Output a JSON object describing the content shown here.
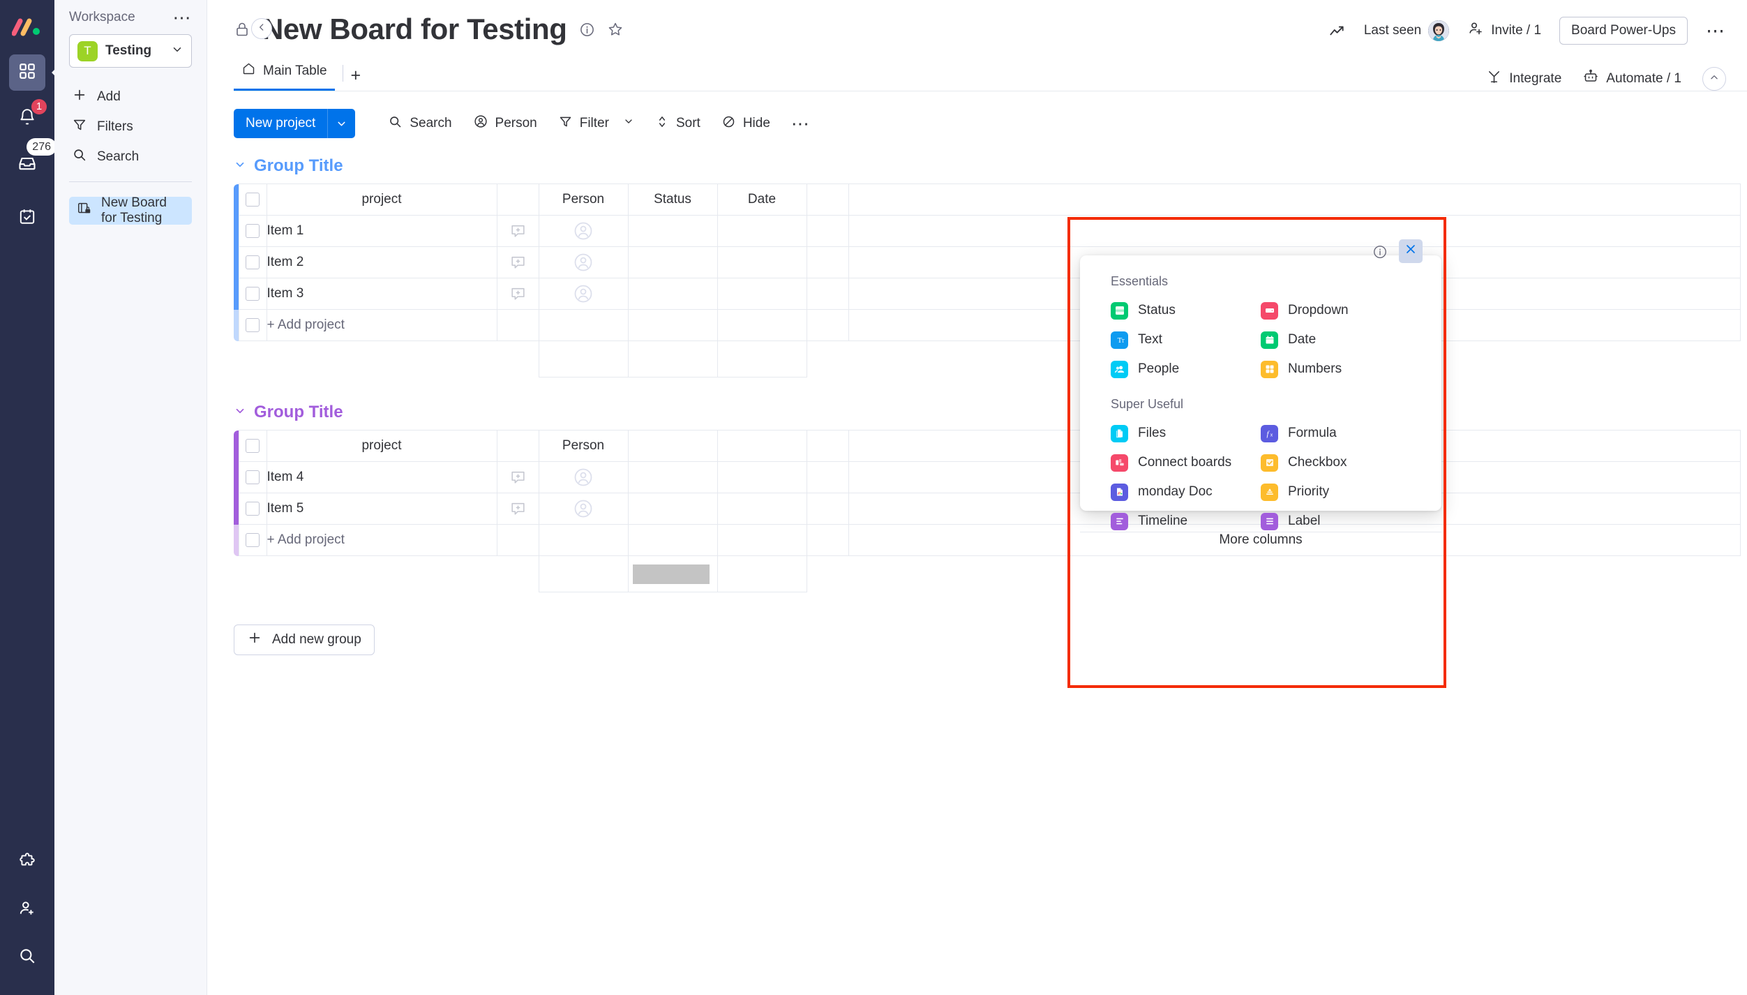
{
  "rail": {
    "logo_name": "monday-logo",
    "items": [
      {
        "name": "apps-grid-icon",
        "badge": ""
      },
      {
        "name": "bell-icon",
        "badge": "1"
      },
      {
        "name": "inbox-icon",
        "badge": "276"
      },
      {
        "name": "my-work-calendar-icon",
        "badge": ""
      }
    ],
    "bottom_items": [
      {
        "name": "puzzle-icon"
      },
      {
        "name": "invite-member-icon"
      },
      {
        "name": "search-icon"
      }
    ]
  },
  "sidebar": {
    "workspace_label": "Workspace",
    "more_icon": "more-dots-icon",
    "workspace_avatar_letter": "T",
    "workspace_name": "Testing",
    "nav": [
      {
        "label": "Add",
        "icon": "plus-icon"
      },
      {
        "label": "Filters",
        "icon": "funnel-icon"
      },
      {
        "label": "Search",
        "icon": "search-icon"
      }
    ],
    "board": {
      "label": "New Board for Testing",
      "icon": "private-board-icon"
    },
    "collapse_icon": "chevron-left-icon"
  },
  "header": {
    "lock_icon": "lock-icon",
    "title": "New Board for Testing",
    "info_icon": "info-circle-icon",
    "star_icon": "star-icon",
    "activity_icon": "activity-trend-icon",
    "last_seen_label": "Last seen",
    "avatar_name": "user-avatar",
    "invite_label": "Invite / 1",
    "invite_icon": "add-person-icon",
    "power_ups_label": "Board Power-Ups",
    "more_icon": "more-dots-icon",
    "integrate_label": "Integrate",
    "integrate_icon": "integrate-icon",
    "automate_label": "Automate / 1",
    "automate_icon": "robot-icon",
    "collapse_header_icon": "chevron-up-icon",
    "tabs": [
      {
        "label": "Main Table",
        "icon": "home-icon",
        "active": true
      }
    ],
    "add_tab_label": "+"
  },
  "toolbar": {
    "new_project_label": "New project",
    "new_project_caret": "chevron-down-icon",
    "items": [
      {
        "label": "Search",
        "icon": "search-icon",
        "caret": false
      },
      {
        "label": "Person",
        "icon": "person-circle-icon",
        "caret": false
      },
      {
        "label": "Filter",
        "icon": "funnel-icon",
        "caret": true
      },
      {
        "label": "Sort",
        "icon": "sort-arrows-icon",
        "caret": false
      },
      {
        "label": "Hide",
        "icon": "hide-eye-icon",
        "caret": false
      }
    ],
    "more_icon": "more-dots-icon"
  },
  "table": {
    "columns": [
      "project",
      "Person",
      "Status",
      "Date"
    ],
    "add_column_icon": "plus-icon",
    "add_row_label": "+ Add project",
    "groups": [
      {
        "title": "Group Title",
        "color": "#579bfc",
        "caret": "chevron-down-icon",
        "rows": [
          {
            "item": "Item 1"
          },
          {
            "item": "Item 2"
          },
          {
            "item": "Item 3"
          }
        ]
      },
      {
        "title": "Group Title",
        "color": "#a25ddc",
        "caret": "chevron-down-icon",
        "rows": [
          {
            "item": "Item 4"
          },
          {
            "item": "Item 5"
          }
        ]
      }
    ],
    "add_new_group_label": "Add new group",
    "add_new_group_icon": "plus-icon"
  },
  "column_popup": {
    "close_icon": "close-x-icon",
    "info_icon": "info-circle-icon",
    "sections": [
      {
        "title": "Essentials",
        "items": [
          {
            "label": "Status",
            "icon": "status-column-icon",
            "color": "#00ca72"
          },
          {
            "label": "Dropdown",
            "icon": "dropdown-column-icon",
            "color": "#f5496a"
          },
          {
            "label": "Text",
            "icon": "text-column-icon",
            "color": "#0f9bf0"
          },
          {
            "label": "Date",
            "icon": "date-column-icon",
            "color": "#00ca72"
          },
          {
            "label": "People",
            "icon": "people-column-icon",
            "color": "#00cbf5"
          },
          {
            "label": "Numbers",
            "icon": "numbers-column-icon",
            "color": "#fdbc2c"
          }
        ]
      },
      {
        "title": "Super Useful",
        "items": [
          {
            "label": "Files",
            "icon": "files-column-icon",
            "color": "#00cbf5"
          },
          {
            "label": "Formula",
            "icon": "formula-column-icon",
            "color": "#5c5ce0"
          },
          {
            "label": "Connect boards",
            "icon": "connect-boards-icon",
            "color": "#f5496a"
          },
          {
            "label": "Checkbox",
            "icon": "checkbox-column-icon",
            "color": "#fdbc2c"
          },
          {
            "label": "monday Doc",
            "icon": "monday-doc-icon",
            "color": "#5c5ce0"
          },
          {
            "label": "Priority",
            "icon": "priority-column-icon",
            "color": "#fdbc2c"
          },
          {
            "label": "Timeline",
            "icon": "timeline-column-icon",
            "color": "#a25ddc"
          },
          {
            "label": "Label",
            "icon": "label-column-icon",
            "color": "#a25ddc"
          }
        ]
      }
    ],
    "footer_label": "More columns"
  },
  "annotation": {
    "name": "red-highlight-rectangle",
    "color": "#f42c04"
  }
}
